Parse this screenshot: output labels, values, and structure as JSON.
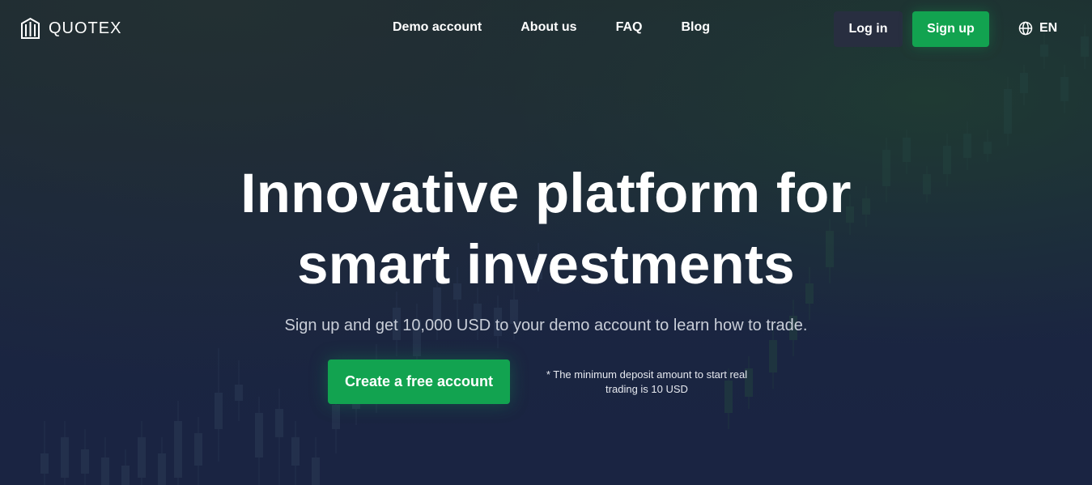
{
  "brand": {
    "name": "QUOTEX",
    "logo_icon": "quotex-bars-icon"
  },
  "nav": {
    "items": [
      {
        "label": "Demo account"
      },
      {
        "label": "About us"
      },
      {
        "label": "FAQ"
      },
      {
        "label": "Blog"
      }
    ]
  },
  "auth": {
    "login_label": "Log in",
    "signup_label": "Sign up"
  },
  "language": {
    "icon": "globe-icon",
    "code": "EN"
  },
  "hero": {
    "title_line1": "Innovative platform for",
    "title_line2": "smart investments",
    "subtitle": "Sign up and get 10,000 USD to your demo account to learn how to trade.",
    "cta_label": "Create a free account",
    "note": "* The minimum deposit amount to start real trading is 10 USD"
  },
  "colors": {
    "accent_green": "#12a350",
    "login_bg": "#282e40",
    "background": "#1b2640"
  }
}
